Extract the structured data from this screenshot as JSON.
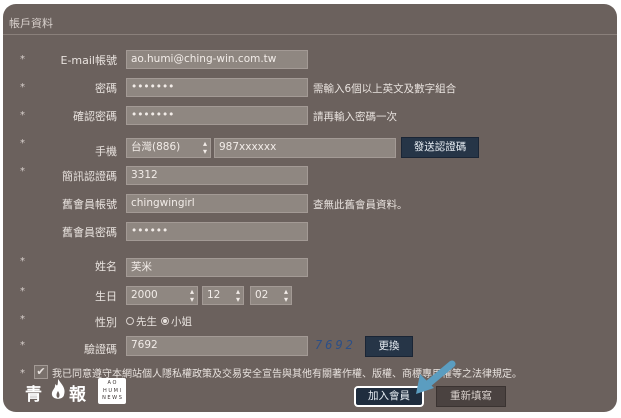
{
  "section_title": "帳戶資料",
  "form": {
    "email": {
      "label": "E-mail帳號",
      "value": "ao.humi@ching-win.com.tw"
    },
    "password": {
      "label": "密碼",
      "value": "•••••••",
      "hint": "需輸入6個以上英文及數字組合"
    },
    "password_confirm": {
      "label": "確認密碼",
      "value": "•••••••",
      "hint": "請再輸入密碼一次"
    },
    "phone": {
      "label": "手機",
      "country": "台灣(886)",
      "number": "987xxxxxx",
      "send_button": "發送認證碼"
    },
    "sms_code": {
      "label": "簡訊認證碼",
      "value": "3312"
    },
    "old_account": {
      "label": "舊會員帳號",
      "value": "chingwingirl",
      "hint": "查無此舊會員資料。"
    },
    "old_password": {
      "label": "舊會員密碼",
      "value": "••••••"
    },
    "name": {
      "label": "姓名",
      "value": "芙米"
    },
    "birthday": {
      "label": "生日",
      "year": "2000",
      "month": "12",
      "day": "02"
    },
    "gender": {
      "label": "性別",
      "male": "先生",
      "female": "小姐",
      "selected": "female"
    },
    "captcha": {
      "label": "驗證碼",
      "value": "7692",
      "image_text": "7692",
      "refresh_button": "更換"
    },
    "agreement": {
      "text": "我已同意遵守本網站個人隱私權政策及交易安全宣告與其他有關著作權、版權、商標專用權等之法律規定。",
      "checked": true
    },
    "submit_button": "加入會員",
    "reset_button": "重新填寫"
  },
  "logo": {
    "text": "青",
    "text2": "報",
    "sub_lines": [
      "A O",
      "H U M I",
      "N E W S"
    ]
  },
  "colors": {
    "highlight_arrow": "#5b9dc0",
    "button_dark": "#263547"
  }
}
